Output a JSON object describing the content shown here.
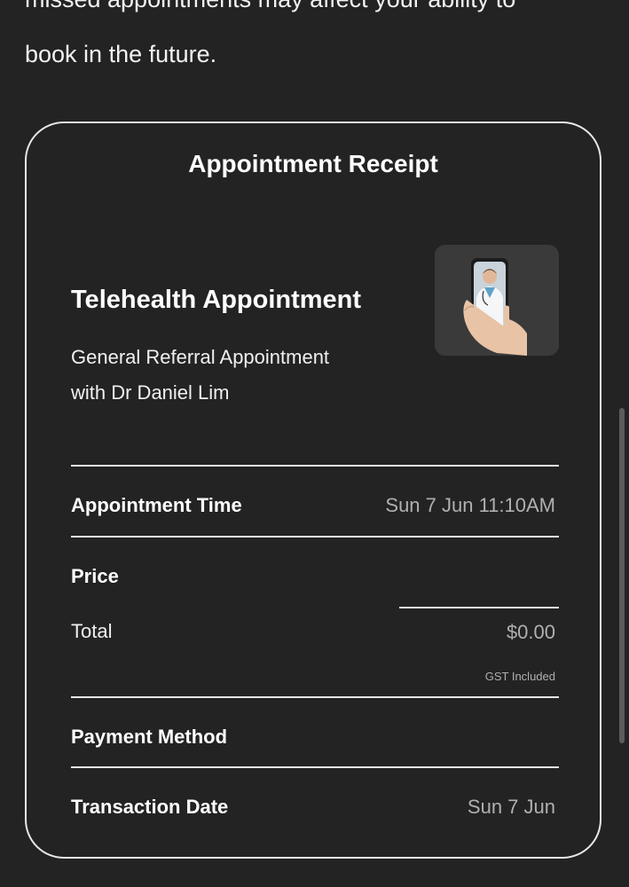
{
  "intro": {
    "line1": "missed appointments may affect your ability to",
    "line2": "book in the future."
  },
  "receipt": {
    "title": "Appointment Receipt",
    "appointment_type": "Telehealth Appointment",
    "description_line1": "General Referral Appointment",
    "description_line2": "with Dr Daniel Lim",
    "thumbnail_icon": "telehealth-phone-doctor-icon",
    "rows": {
      "appointment_time": {
        "label": "Appointment Time",
        "value": "Sun 7 Jun 11:10AM"
      },
      "price": {
        "label": "Price"
      },
      "total": {
        "label": "Total",
        "value": "$0.00",
        "note": "GST Included"
      },
      "payment_method": {
        "label": "Payment Method"
      },
      "transaction_date": {
        "label": "Transaction Date",
        "value": "Sun 7 Jun"
      }
    }
  },
  "colors": {
    "background": "#232323",
    "text_primary": "#ffffff",
    "text_muted": "#b0b0b0",
    "border": "#e8e8e8"
  }
}
